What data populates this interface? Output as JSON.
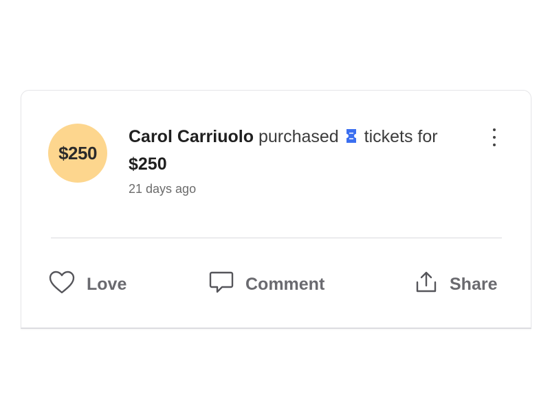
{
  "post": {
    "avatar_text": "$250",
    "author": "Carol Carriuolo",
    "verb": "purchased",
    "item": "tickets for",
    "amount": "$250",
    "time_ago": "21 days ago"
  },
  "actions": {
    "love_label": "Love",
    "comment_label": "Comment",
    "share_label": "Share"
  },
  "icons": {
    "ticket": "ticket-icon",
    "more": "more-vertical-icon",
    "love": "heart-icon",
    "comment": "comment-icon",
    "share": "share-icon"
  },
  "colors": {
    "avatar_bg": "#fdd68e",
    "ticket_icon": "#3b6ff0",
    "action_text": "#6a6a6f"
  }
}
